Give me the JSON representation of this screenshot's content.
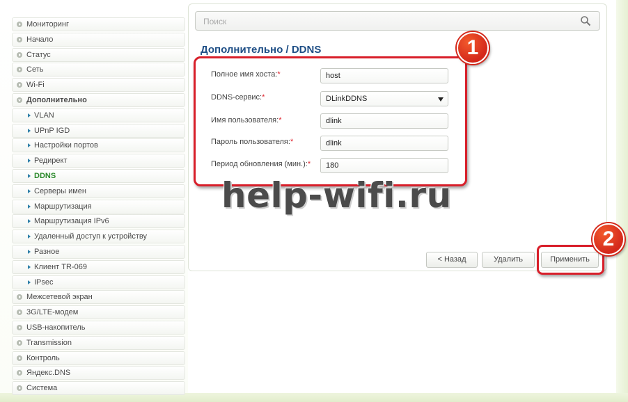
{
  "sidebar": {
    "items": [
      {
        "label": "Мониторинг"
      },
      {
        "label": "Начало"
      },
      {
        "label": "Статус"
      },
      {
        "label": "Сеть"
      },
      {
        "label": "Wi-Fi"
      },
      {
        "label": "Дополнительно"
      },
      {
        "label": "VLAN"
      },
      {
        "label": "UPnP IGD"
      },
      {
        "label": "Настройки портов"
      },
      {
        "label": "Редирект"
      },
      {
        "label": "DDNS"
      },
      {
        "label": "Серверы имен"
      },
      {
        "label": "Маршрутизация"
      },
      {
        "label": "Маршрутизация IPv6"
      },
      {
        "label": "Удаленный доступ к устройству"
      },
      {
        "label": "Разное"
      },
      {
        "label": "Клиент TR-069"
      },
      {
        "label": "IPsec"
      },
      {
        "label": "Межсетевой экран"
      },
      {
        "label": "3G/LTE-модем"
      },
      {
        "label": "USB-накопитель"
      },
      {
        "label": "Transmission"
      },
      {
        "label": "Контроль"
      },
      {
        "label": "Яндекс.DNS"
      },
      {
        "label": "Система"
      }
    ]
  },
  "search": {
    "placeholder": "Поиск"
  },
  "page": {
    "title": "Дополнительно /  DDNS"
  },
  "form": {
    "hostname_label": "Полное имя хоста:",
    "hostname_value": "host",
    "service_label": "DDNS-сервис:",
    "service_value": "DLinkDDNS",
    "user_label": "Имя пользователя:",
    "user_value": "dlink",
    "password_label": "Пароль пользователя:",
    "password_value": "dlink",
    "period_label": "Период обновления (мин.):",
    "period_value": "180",
    "required_mark": "*"
  },
  "buttons": {
    "back": "< Назад",
    "delete": "Удалить",
    "apply": "Применить"
  },
  "annotations": {
    "badge1": "1",
    "badge2": "2",
    "watermark": "help-wifi.ru"
  },
  "colors": {
    "highlight": "#d81f2a",
    "title": "#1f4f86",
    "active": "#2d8a2d"
  }
}
